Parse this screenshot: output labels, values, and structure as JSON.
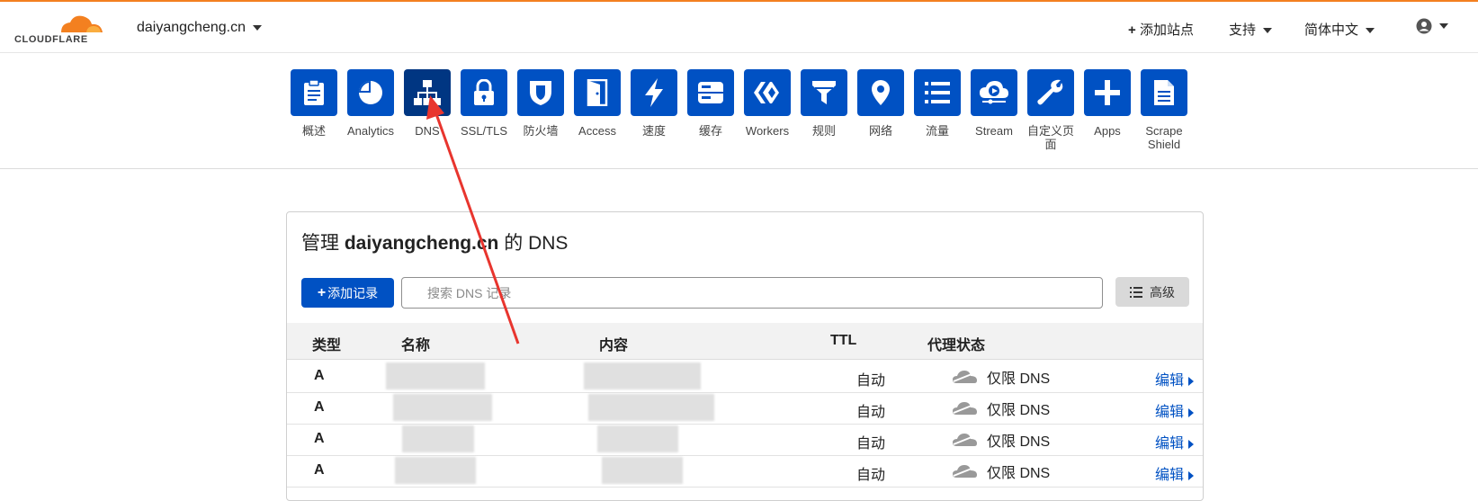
{
  "header": {
    "logo_text": "CLOUDFLARE",
    "site": "daiyangcheng.cn",
    "add_site": "添加站点",
    "support": "支持",
    "language": "简体中文"
  },
  "nav": {
    "items": [
      {
        "label": "概述",
        "icon": "clipboard-icon"
      },
      {
        "label": "Analytics",
        "icon": "pie-chart-icon"
      },
      {
        "label": "DNS",
        "icon": "network-icon",
        "active": true
      },
      {
        "label": "SSL/TLS",
        "icon": "lock-icon"
      },
      {
        "label": "防火墙",
        "icon": "shield-icon"
      },
      {
        "label": "Access",
        "icon": "door-icon"
      },
      {
        "label": "速度",
        "icon": "lightning-icon"
      },
      {
        "label": "缓存",
        "icon": "server-icon"
      },
      {
        "label": "Workers",
        "icon": "workers-icon"
      },
      {
        "label": "规则",
        "icon": "filter-icon"
      },
      {
        "label": "网络",
        "icon": "location-pin-icon"
      },
      {
        "label": "流量",
        "icon": "list-icon"
      },
      {
        "label": "Stream",
        "icon": "cloud-play-icon"
      },
      {
        "label": "自定义页面",
        "icon": "wrench-icon"
      },
      {
        "label": "Apps",
        "icon": "plus-icon"
      },
      {
        "label": "Scrape Shield",
        "icon": "document-icon"
      }
    ]
  },
  "dns": {
    "title_prefix": "管理",
    "title_domain": "daiyangcheng.cn",
    "title_suffix": "的 DNS",
    "add_record": "添加记录",
    "search_placeholder": "搜索 DNS 记录",
    "advanced": "高级",
    "columns": {
      "type": "类型",
      "name": "名称",
      "content": "内容",
      "ttl": "TTL",
      "proxy": "代理状态"
    },
    "rows": [
      {
        "type": "A",
        "ttl": "自动",
        "proxy": "仅限 DNS",
        "edit": "编辑"
      },
      {
        "type": "A",
        "ttl": "自动",
        "proxy": "仅限 DNS",
        "edit": "编辑"
      },
      {
        "type": "A",
        "ttl": "自动",
        "proxy": "仅限 DNS",
        "edit": "编辑"
      },
      {
        "type": "A",
        "ttl": "自动",
        "proxy": "仅限 DNS",
        "edit": "编辑"
      }
    ]
  },
  "colors": {
    "brand_orange": "#f38020",
    "primary_blue": "#0051c3",
    "active_tile": "#003682",
    "annotation_arrow": "#e8352e"
  }
}
